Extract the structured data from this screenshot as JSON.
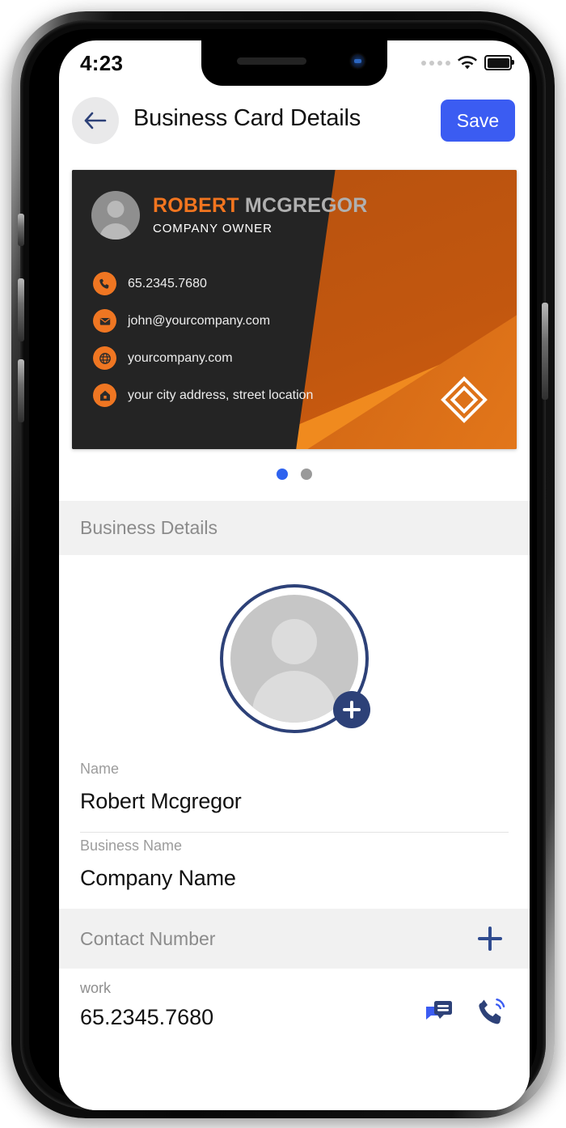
{
  "status_bar": {
    "time": "4:23",
    "signal_icon": "signal-dots-icon",
    "wifi_icon": "wifi-icon",
    "battery_icon": "battery-full-icon"
  },
  "app_bar": {
    "back_icon": "arrow-left-icon",
    "title": "Business Card Details",
    "save_label": "Save",
    "save_color": "#3b5cf2"
  },
  "business_card": {
    "first_name": "ROBERT",
    "last_name": "MCGREGOR",
    "role": "COMPANY OWNER",
    "first_name_color": "#f2751f",
    "last_name_color": "#b0b0b0",
    "background_color": "#242424",
    "accent_color": "#f7941d",
    "logo_icon": "diamond-logo-icon",
    "avatar_icon": "person-avatar-icon",
    "contacts": [
      {
        "icon": "phone-icon",
        "text": "65.2345.7680"
      },
      {
        "icon": "envelope-icon",
        "text": "john@yourcompany.com"
      },
      {
        "icon": "globe-icon",
        "text": "yourcompany.com"
      },
      {
        "icon": "home-icon",
        "text": "your city address, street location"
      }
    ]
  },
  "pager": {
    "total": 2,
    "active_index": 0,
    "active_color": "#2f63ef",
    "inactive_color": "#9a9a9a"
  },
  "business_details": {
    "section_title": "Business Details",
    "avatar_icon": "person-avatar-icon",
    "add_photo_icon": "plus-icon",
    "ring_color": "#2d4178",
    "fields": [
      {
        "label": "Name",
        "value": "Robert Mcgregor"
      },
      {
        "label": "Business Name",
        "value": "Company Name"
      }
    ]
  },
  "contact_number": {
    "section_title": "Contact Number",
    "add_icon": "plus-icon",
    "rows": [
      {
        "label": "work",
        "value": "65.2345.7680",
        "message_icon": "message-bubble-icon",
        "call_icon": "phone-call-icon"
      }
    ]
  }
}
